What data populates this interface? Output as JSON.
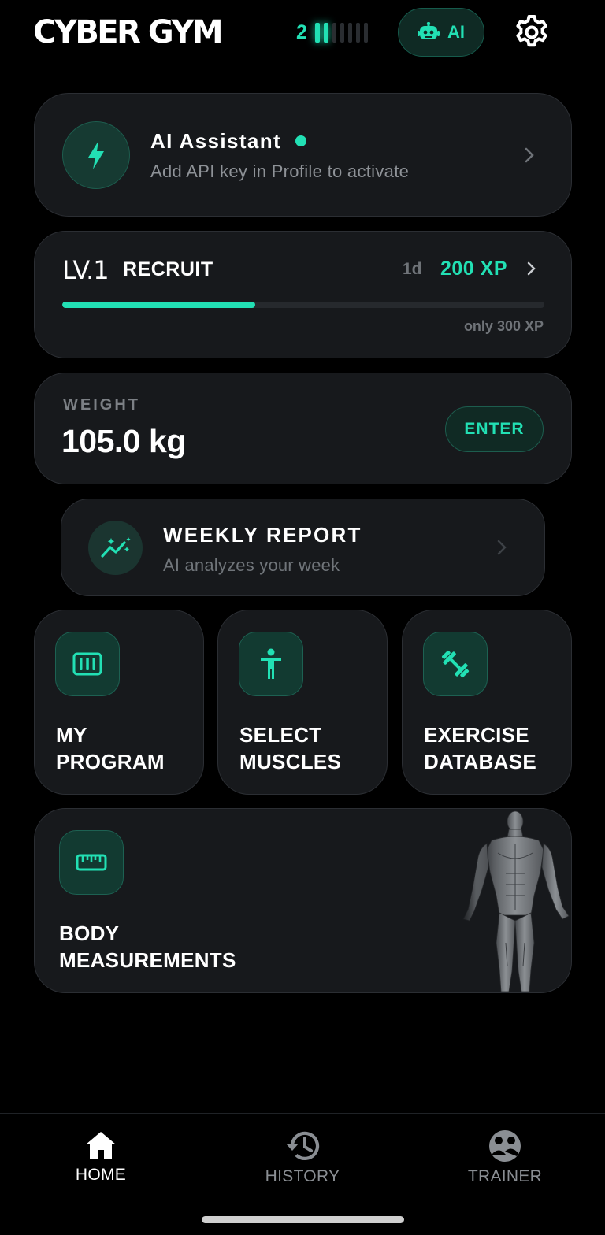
{
  "app": {
    "title": "CYBER GYM"
  },
  "header": {
    "streak_count": "2",
    "streak": {
      "active": 1,
      "total": 7
    },
    "ai_label": "AI"
  },
  "assistant": {
    "title": "AI Assistant",
    "subtitle": "Add API key in Profile to activate",
    "status_color": "#22e0b4"
  },
  "level": {
    "level": "LV.1",
    "rank": "RECRUIT",
    "days": "1d",
    "xp": "200 XP",
    "remaining": "only 300 XP",
    "progress_fraction": 0.4
  },
  "weight": {
    "label": "WEIGHT",
    "value": "105.0 kg",
    "enter_label": "ENTER"
  },
  "report": {
    "title": "WEEKLY REPORT",
    "subtitle": "AI analyzes your week"
  },
  "tiles": [
    {
      "line1": "MY",
      "line2": "PROGRAM",
      "icon": "program-icon"
    },
    {
      "line1": "SELECT",
      "line2": "MUSCLES",
      "icon": "body-icon"
    },
    {
      "line1": "EXERCISE",
      "line2": "DATABASE",
      "icon": "dumbbell-icon"
    }
  ],
  "measurements": {
    "line1": "BODY",
    "line2": "MEASUREMENTS",
    "icon": "ruler-icon"
  },
  "nav": [
    {
      "label": "HOME",
      "icon": "home-icon",
      "active": true
    },
    {
      "label": "HISTORY",
      "icon": "history-icon",
      "active": false
    },
    {
      "label": "TRAINER",
      "icon": "trainer-icon",
      "active": false
    }
  ],
  "colors": {
    "accent": "#22e0b4",
    "card": "#17191c",
    "background": "#000000",
    "muted": "#6f7378"
  }
}
